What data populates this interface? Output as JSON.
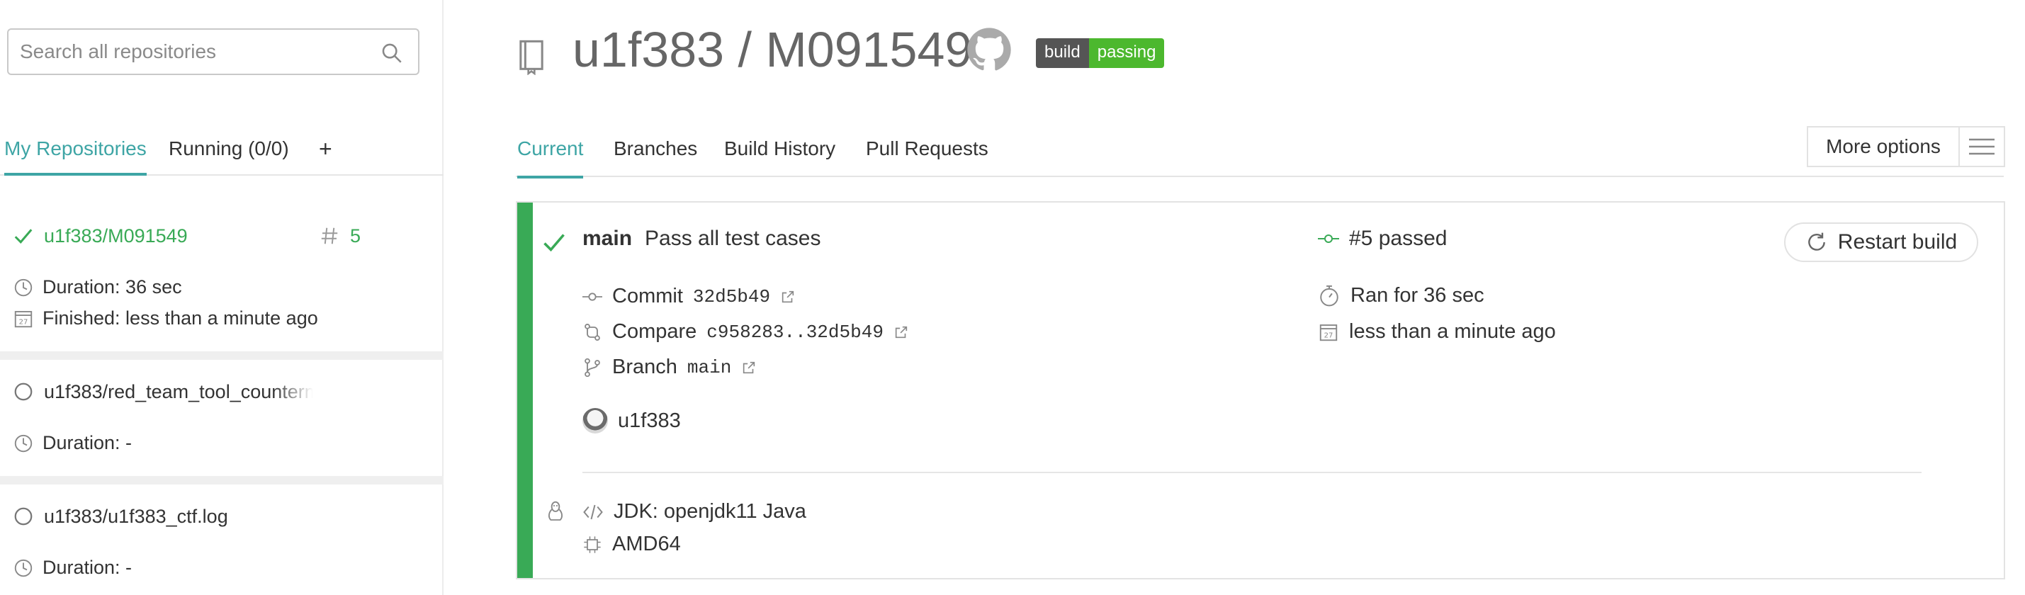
{
  "search": {
    "placeholder": "Search all repositories"
  },
  "left_tabs": {
    "my_repos": "My Repositories",
    "running": "Running (0/0)",
    "add": "+"
  },
  "repos": [
    {
      "name": "u1f383/M091549",
      "number": "5",
      "duration": "Duration: 36 sec",
      "finished": "Finished: less than a minute ago"
    },
    {
      "name": "u1f383/red_team_tool_counterm",
      "duration": "Duration: -"
    },
    {
      "name": "u1f383/u1f383_ctf.log",
      "duration": "Duration: -"
    }
  ],
  "header": {
    "title": "u1f383 / M091549",
    "badge_left": "build",
    "badge_right": "passing"
  },
  "main_tabs": [
    "Current",
    "Branches",
    "Build History",
    "Pull Requests"
  ],
  "more_options": "More options",
  "build": {
    "branch": "main",
    "message": "Pass all test cases",
    "status": "#5 passed",
    "restart": "Restart build",
    "commit_label": "Commit",
    "commit_hash": "32d5b49",
    "compare_label": "Compare",
    "compare_range": "c958283..32d5b49",
    "branch_label": "Branch",
    "branch_value": "main",
    "author": "u1f383",
    "ran_for": "Ran for 36 sec",
    "finished": "less than a minute ago",
    "jdk": "JDK: openjdk11 Java",
    "arch": "AMD64"
  },
  "colors": {
    "accent": "#3ea5a5",
    "passed": "#39aa56",
    "badge_green": "#4cb82e"
  }
}
